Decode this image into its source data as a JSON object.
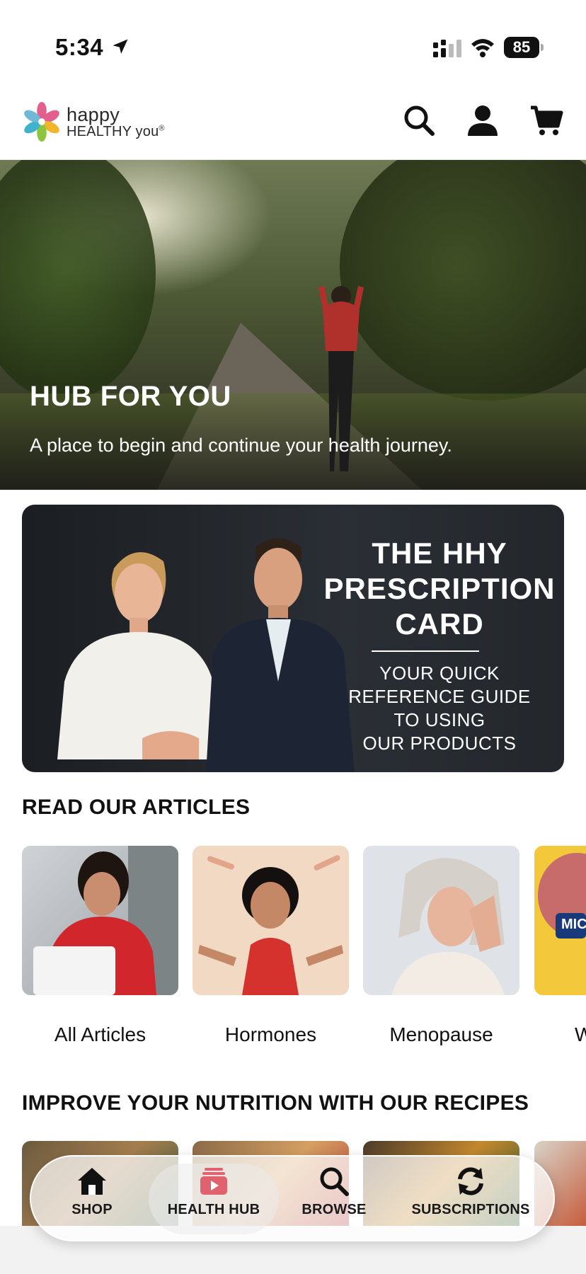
{
  "status_bar": {
    "time": "5:34",
    "battery": "85",
    "icons": [
      "location-arrow-icon",
      "cellular-signal-icon",
      "wifi-icon",
      "battery-icon"
    ]
  },
  "header": {
    "logo": {
      "line1": "happy",
      "line2": "HEALTHY you",
      "mark": "®"
    },
    "icons": [
      "search-icon",
      "account-icon",
      "cart-icon"
    ]
  },
  "hero": {
    "title": "HUB FOR YOU",
    "subtitle": "A place to begin and continue your health journey."
  },
  "prescription_card": {
    "title_lines": [
      "THE HHY",
      "PRESCRIPTION",
      "CARD"
    ],
    "subtitle_lines": [
      "YOUR QUICK",
      "REFERENCE GUIDE",
      "TO USING",
      "OUR PRODUCTS"
    ]
  },
  "articles": {
    "heading": "READ OUR ARTICLES",
    "items": [
      {
        "label": "All Articles"
      },
      {
        "label": "Hormones"
      },
      {
        "label": "Menopause"
      },
      {
        "label": "W"
      }
    ],
    "partial_tile_text": "MIC"
  },
  "recipes": {
    "heading": "IMPROVE YOUR NUTRITION WITH OUR RECIPES"
  },
  "bottom_nav": {
    "items": [
      {
        "label": "SHOP",
        "icon": "home-icon"
      },
      {
        "label": "HEALTH HUB",
        "icon": "health-hub-play-icon",
        "active": true
      },
      {
        "label": "BROWSE",
        "icon": "search-icon"
      },
      {
        "label": "SUBSCRIPTIONS",
        "icon": "refresh-icon"
      }
    ],
    "active_color": "#e0626e"
  }
}
